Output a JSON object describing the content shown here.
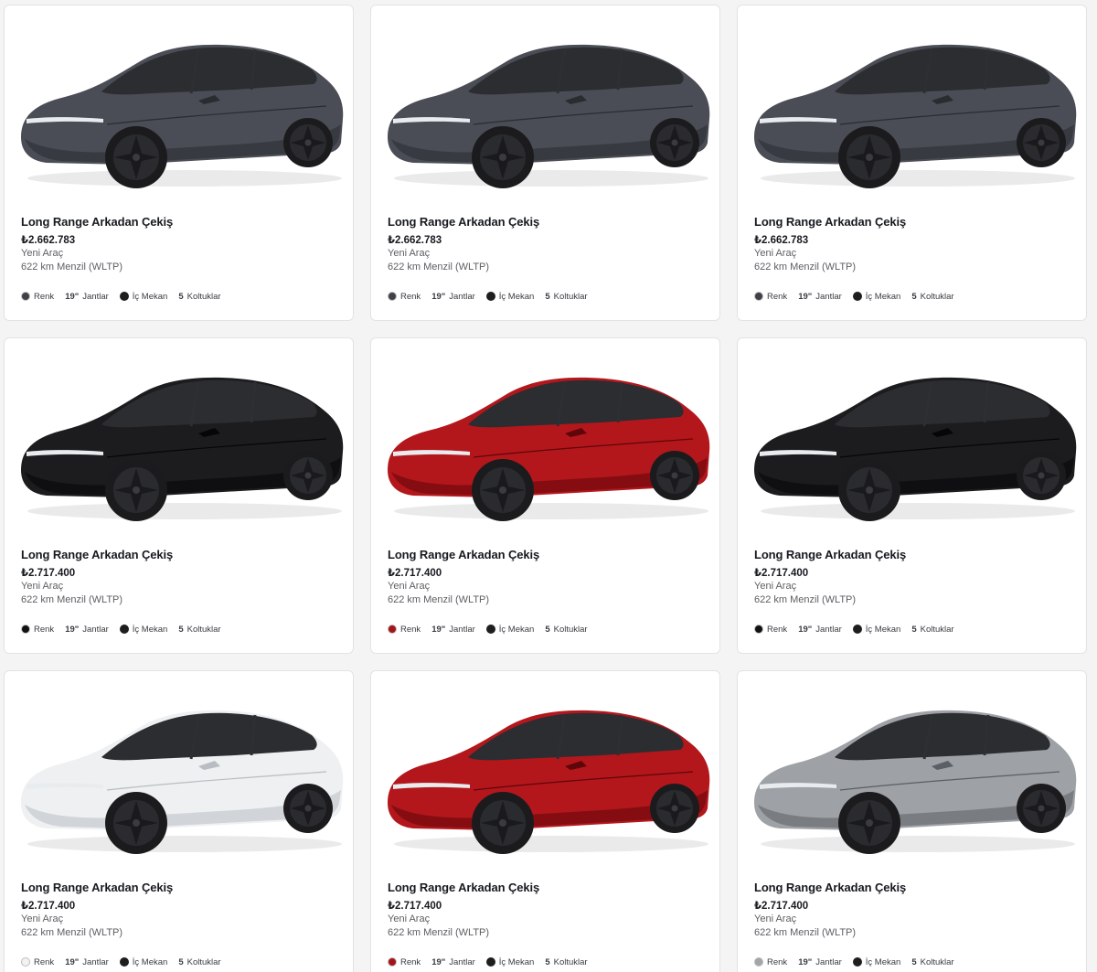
{
  "cards": [
    {
      "title": "Long Range Arkadan Çekiş",
      "price": "₺2.662.783",
      "condition": "Yeni Araç",
      "range": "622 km Menzil (WLTP)",
      "color_label": "Renk",
      "wheel_size": "19\"",
      "wheel_label": "Jantlar",
      "interior_label": "İç Mekan",
      "seats": "5",
      "seats_label": "Koltuklar",
      "paint_color": "#4a4d55",
      "paint_shade": "#2a2c31",
      "swatch_color": "#3f4148"
    },
    {
      "title": "Long Range Arkadan Çekiş",
      "price": "₺2.662.783",
      "condition": "Yeni Araç",
      "range": "622 km Menzil (WLTP)",
      "color_label": "Renk",
      "wheel_size": "19\"",
      "wheel_label": "Jantlar",
      "interior_label": "İç Mekan",
      "seats": "5",
      "seats_label": "Koltuklar",
      "paint_color": "#4a4d55",
      "paint_shade": "#2a2c31",
      "swatch_color": "#3f4148"
    },
    {
      "title": "Long Range Arkadan Çekiş",
      "price": "₺2.662.783",
      "condition": "Yeni Araç",
      "range": "622 km Menzil (WLTP)",
      "color_label": "Renk",
      "wheel_size": "19\"",
      "wheel_label": "Jantlar",
      "interior_label": "İç Mekan",
      "seats": "5",
      "seats_label": "Koltuklar",
      "paint_color": "#4a4d55",
      "paint_shade": "#2a2c31",
      "swatch_color": "#3f4148"
    },
    {
      "title": "Long Range Arkadan Çekiş",
      "price": "₺2.717.400",
      "condition": "Yeni Araç",
      "range": "622 km Menzil (WLTP)",
      "color_label": "Renk",
      "wheel_size": "19\"",
      "wheel_label": "Jantlar",
      "interior_label": "İç Mekan",
      "seats": "5",
      "seats_label": "Koltuklar",
      "paint_color": "#1c1c1f",
      "paint_shade": "#060607",
      "swatch_color": "#111113"
    },
    {
      "title": "Long Range Arkadan Çekiş",
      "price": "₺2.717.400",
      "condition": "Yeni Araç",
      "range": "622 km Menzil (WLTP)",
      "color_label": "Renk",
      "wheel_size": "19\"",
      "wheel_label": "Jantlar",
      "interior_label": "İç Mekan",
      "seats": "5",
      "seats_label": "Koltuklar",
      "paint_color": "#b3171c",
      "paint_shade": "#5e0609",
      "swatch_color": "#a51418"
    },
    {
      "title": "Long Range Arkadan Çekiş",
      "price": "₺2.717.400",
      "condition": "Yeni Araç",
      "range": "622 km Menzil (WLTP)",
      "color_label": "Renk",
      "wheel_size": "19\"",
      "wheel_label": "Jantlar",
      "interior_label": "İç Mekan",
      "seats": "5",
      "seats_label": "Koltuklar",
      "paint_color": "#1c1c1f",
      "paint_shade": "#060607",
      "swatch_color": "#111113"
    },
    {
      "title": "Long Range Arkadan Çekiş",
      "price": "₺2.717.400",
      "condition": "Yeni Araç",
      "range": "622 km Menzil (WLTP)",
      "color_label": "Renk",
      "wheel_size": "19\"",
      "wheel_label": "Jantlar",
      "interior_label": "İç Mekan",
      "seats": "5",
      "seats_label": "Koltuklar",
      "paint_color": "#eef0f2",
      "paint_shade": "#b9bdc2",
      "swatch_color": "#f2f2f2"
    },
    {
      "title": "Long Range Arkadan Çekiş",
      "price": "₺2.717.400",
      "condition": "Yeni Araç",
      "range": "622 km Menzil (WLTP)",
      "color_label": "Renk",
      "wheel_size": "19\"",
      "wheel_label": "Jantlar",
      "interior_label": "İç Mekan",
      "seats": "5",
      "seats_label": "Koltuklar",
      "paint_color": "#b3171c",
      "paint_shade": "#5e0609",
      "swatch_color": "#a51418"
    },
    {
      "title": "Long Range Arkadan Çekiş",
      "price": "₺2.717.400",
      "condition": "Yeni Araç",
      "range": "622 km Menzil (WLTP)",
      "color_label": "Renk",
      "wheel_size": "19\"",
      "wheel_label": "Jantlar",
      "interior_label": "İç Mekan",
      "seats": "5",
      "seats_label": "Koltuklar",
      "paint_color": "#9ea1a6",
      "paint_shade": "#5b5e63",
      "swatch_color": "#a3a5a8"
    }
  ]
}
